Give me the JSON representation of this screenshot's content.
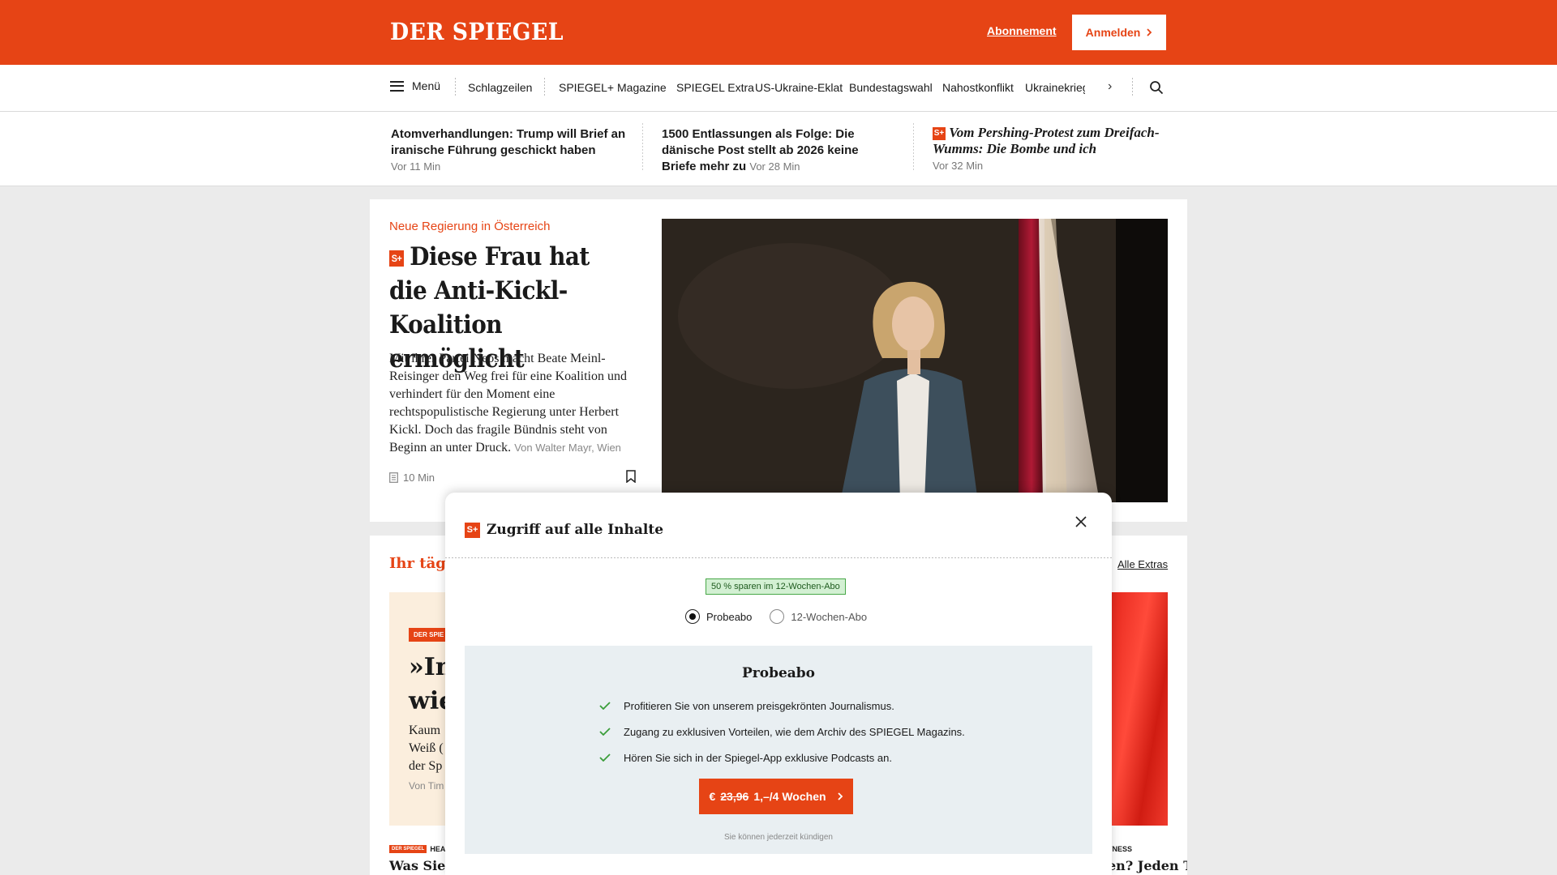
{
  "header": {
    "logo": "DER SPIEGEL",
    "abo_link": "Abonnement",
    "login_button": "Anmelden",
    "brand_color": "#e64415"
  },
  "nav": {
    "menu_label": "Menü",
    "items": [
      "Schlagzeilen",
      "SPIEGEL+",
      "Magazine",
      "SPIEGEL Extra",
      "US-Ukraine-Eklat",
      "Bundestagswahl",
      "Nahostkonflikt",
      "Ukrainekrieg"
    ],
    "icons": [
      "hamburger-icon",
      "chevron-right-icon",
      "search-icon"
    ]
  },
  "ticker": [
    {
      "title": "Atomverhandlungen: Trump will Brief an iranische Führung geschickt haben",
      "time": "Vor 11 Min"
    },
    {
      "title": "1500 Entlassungen als Folge: Die dänische Post stellt ab 2026 keine Briefe mehr zu",
      "time": "Vor 28 Min"
    },
    {
      "title": "Vom Pershing-Protest zum Dreifach-Wumms: Die Bombe und ich",
      "time": "Vor 32 Min"
    }
  ],
  "lead": {
    "kicker": "Neue Regierung in Österreich",
    "badge": "S+",
    "headline": "Diese Frau hat die Anti-Kickl-Koalition ermöglicht",
    "teaser": "Mit ihrer Partei Neos macht Beate Meinl-Reisinger den Weg frei für eine Koalition und verhindert für den Moment eine rechtspopulistische Regierung unter Herbert Kickl. Doch das fragile Bündnis steht von Beginn an unter Druck.",
    "author": "Von Walter Mayr, Wien",
    "read_time": "10 Min"
  },
  "section2": {
    "title": "Ihr täglic",
    "all_extras": "Alle Extras",
    "card_tag": "DER SPIE",
    "card_big_lines": [
      "»In",
      "wie"
    ],
    "card_text_lines": [
      "Kaum",
      "Weiß (",
      "der Sp"
    ],
    "card_by": "Von Tim",
    "bottom_tag": "HEALT",
    "bottom_tag_mini": "DER SPIEGEL",
    "bottom_headline": "Was Sie e",
    "right_tag": "TNESS",
    "right_headline": "en? Jeden Ta"
  },
  "modal": {
    "badge": "S+",
    "title": "Zugriff auf alle Inhalte",
    "save_badge": "50 % sparen im 12-Wochen-Abo",
    "options": [
      {
        "label": "Probeabo",
        "selected": true
      },
      {
        "label": "12-Wochen-Abo",
        "selected": false
      }
    ],
    "plan_title": "Probeabo",
    "benefits": [
      "Profitieren Sie von unserem preisgekrönten Journalismus.",
      "Zugang zu exklusiven Vorteilen, wie dem Archiv des SPIEGEL Magazins.",
      "Hören Sie sich in der Spiegel-App exklusive Podcasts an."
    ],
    "cta_prefix": "€",
    "cta_old_price": "23,96",
    "cta_price": "1,–/4 Wochen",
    "cancel_note": "Sie können jederzeit kündigen",
    "check_color": "#3a9d3a"
  }
}
